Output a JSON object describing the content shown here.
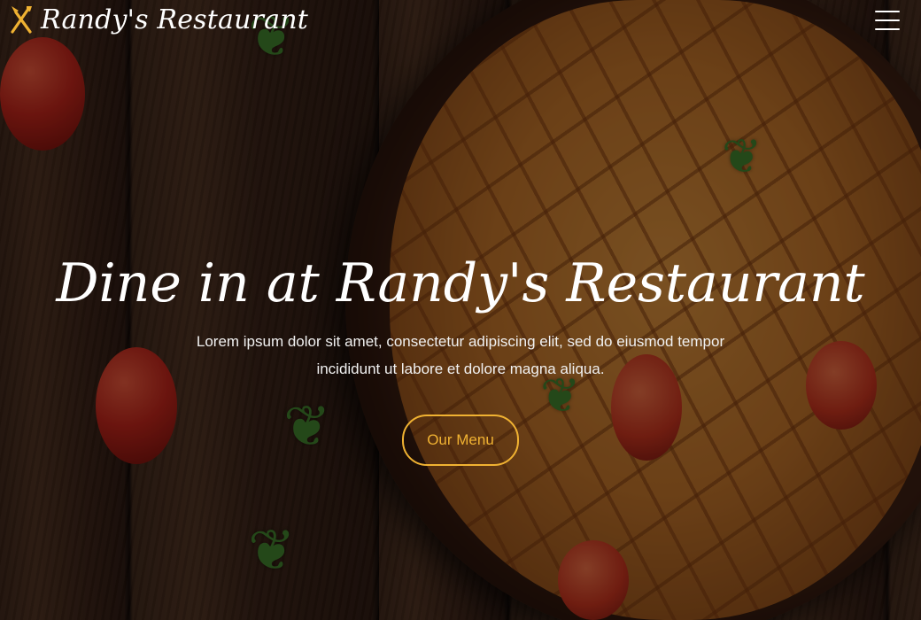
{
  "header": {
    "brand_name": "Randy's Restaurant",
    "brand_icon": "fork-knife-icon",
    "menu_icon": "hamburger-menu-icon"
  },
  "hero": {
    "title": "Dine in at Randy's Restaurant",
    "description": "Lorem ipsum dolor sit amet, consectetur adipiscing elit, sed do eiusmod tempor incididunt ut labore et dolore magna aliqua.",
    "cta_label": "Our Menu"
  },
  "colors": {
    "accent": "#f0b232",
    "text": "#ffffff"
  }
}
